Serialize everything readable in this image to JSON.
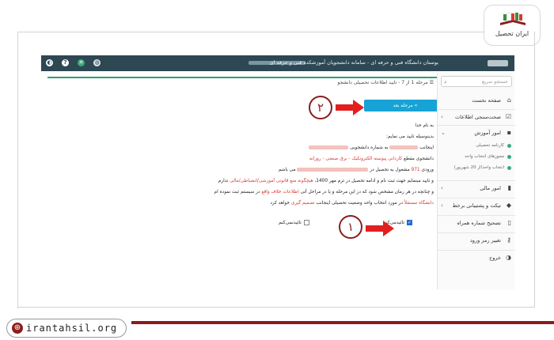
{
  "logo": {
    "text": "ایران تحصیل"
  },
  "footer": {
    "url": "irantahsil.org"
  },
  "topbar": {
    "title": "بوستان دانشگاه فنی و حرفه ای - سامانه دانشجویان آموزشکده فنی و حرفه ای"
  },
  "breadcrumb": "مرحله 1 از 7 - تایید اطلاعات تحصیلی دانشجو",
  "next_button": "مرحله بعد",
  "search": {
    "placeholder": "جستجو سریع"
  },
  "sidebar": {
    "items": [
      {
        "label": "صفحه نخست",
        "icon": "home-icon"
      },
      {
        "label": "صحت‌سنجی اطلاعات",
        "icon": "check-icon"
      },
      {
        "label": "امور آموزش",
        "icon": "folder-icon"
      }
    ],
    "subitems": [
      {
        "label": "کارنامه تحصیلی"
      },
      {
        "label": "مجوزهای انتخاب واحد"
      },
      {
        "label": "انتخاب واحد(از 20 شهریور)"
      }
    ],
    "items2": [
      {
        "label": "امور مالی",
        "icon": "wallet-icon"
      },
      {
        "label": "تیکت و پشتیبانی برخط",
        "icon": "ticket-icon"
      },
      {
        "label": "تصحیح شماره همراه",
        "icon": "phone-icon"
      },
      {
        "label": "تغییر رمز ورود",
        "icon": "key-icon"
      },
      {
        "label": "خروج",
        "icon": "toggle-icon"
      }
    ]
  },
  "content": {
    "greeting": "به نام خدا",
    "intro": "بدینوسیله تایید می نمایم:",
    "line1_a": "اینجانب",
    "line1_b": "به شماره دانشجویی",
    "line2_a": "دانشجوی مقطع",
    "line2_b": "کاردانی پیوسته الکترونکیک - برق صنعتی - روزانه",
    "line3_a": "ورودی",
    "line3_year": "971",
    "line3_b": "مشغول به تحصیل در",
    "line3_c": "می باشم",
    "line4_a": "و تایید مینمایم جهت ثبت نام و ادامه تحصیل در ترم مهر 1400،",
    "line4_b": "هیچگونه منع قانونی آموزشی/انضباطی/مالی",
    "line4_c": "ندارم",
    "line5_a": "و چنانچه در هر زمان مشخص شود که در این مرحله و یا در مراحل آتی",
    "line5_b": "اطلاعات خلاف واقع",
    "line5_c": "در سیستم ثبت نموده ام",
    "line6_a": "دانشگاه مستقلاً",
    "line6_b": "در مورد انتخاب واحد وضعیت تحصیلی اینجانب",
    "line6_c": "تصمیم گیری",
    "line6_d": "خواهد کرد"
  },
  "checkboxes": {
    "confirm": "تائیدمی‌کنم",
    "reject": "تائیدنمی‌کنم",
    "confirm_checked": true,
    "reject_checked": false
  },
  "annotations": {
    "step1": "۱",
    "step2": "۲"
  },
  "colors": {
    "topbar": "#2d4753",
    "accent": "#18a3d6",
    "red_text": "#d9352f",
    "brand": "#8b1d1d",
    "success": "#2e9e6e"
  }
}
